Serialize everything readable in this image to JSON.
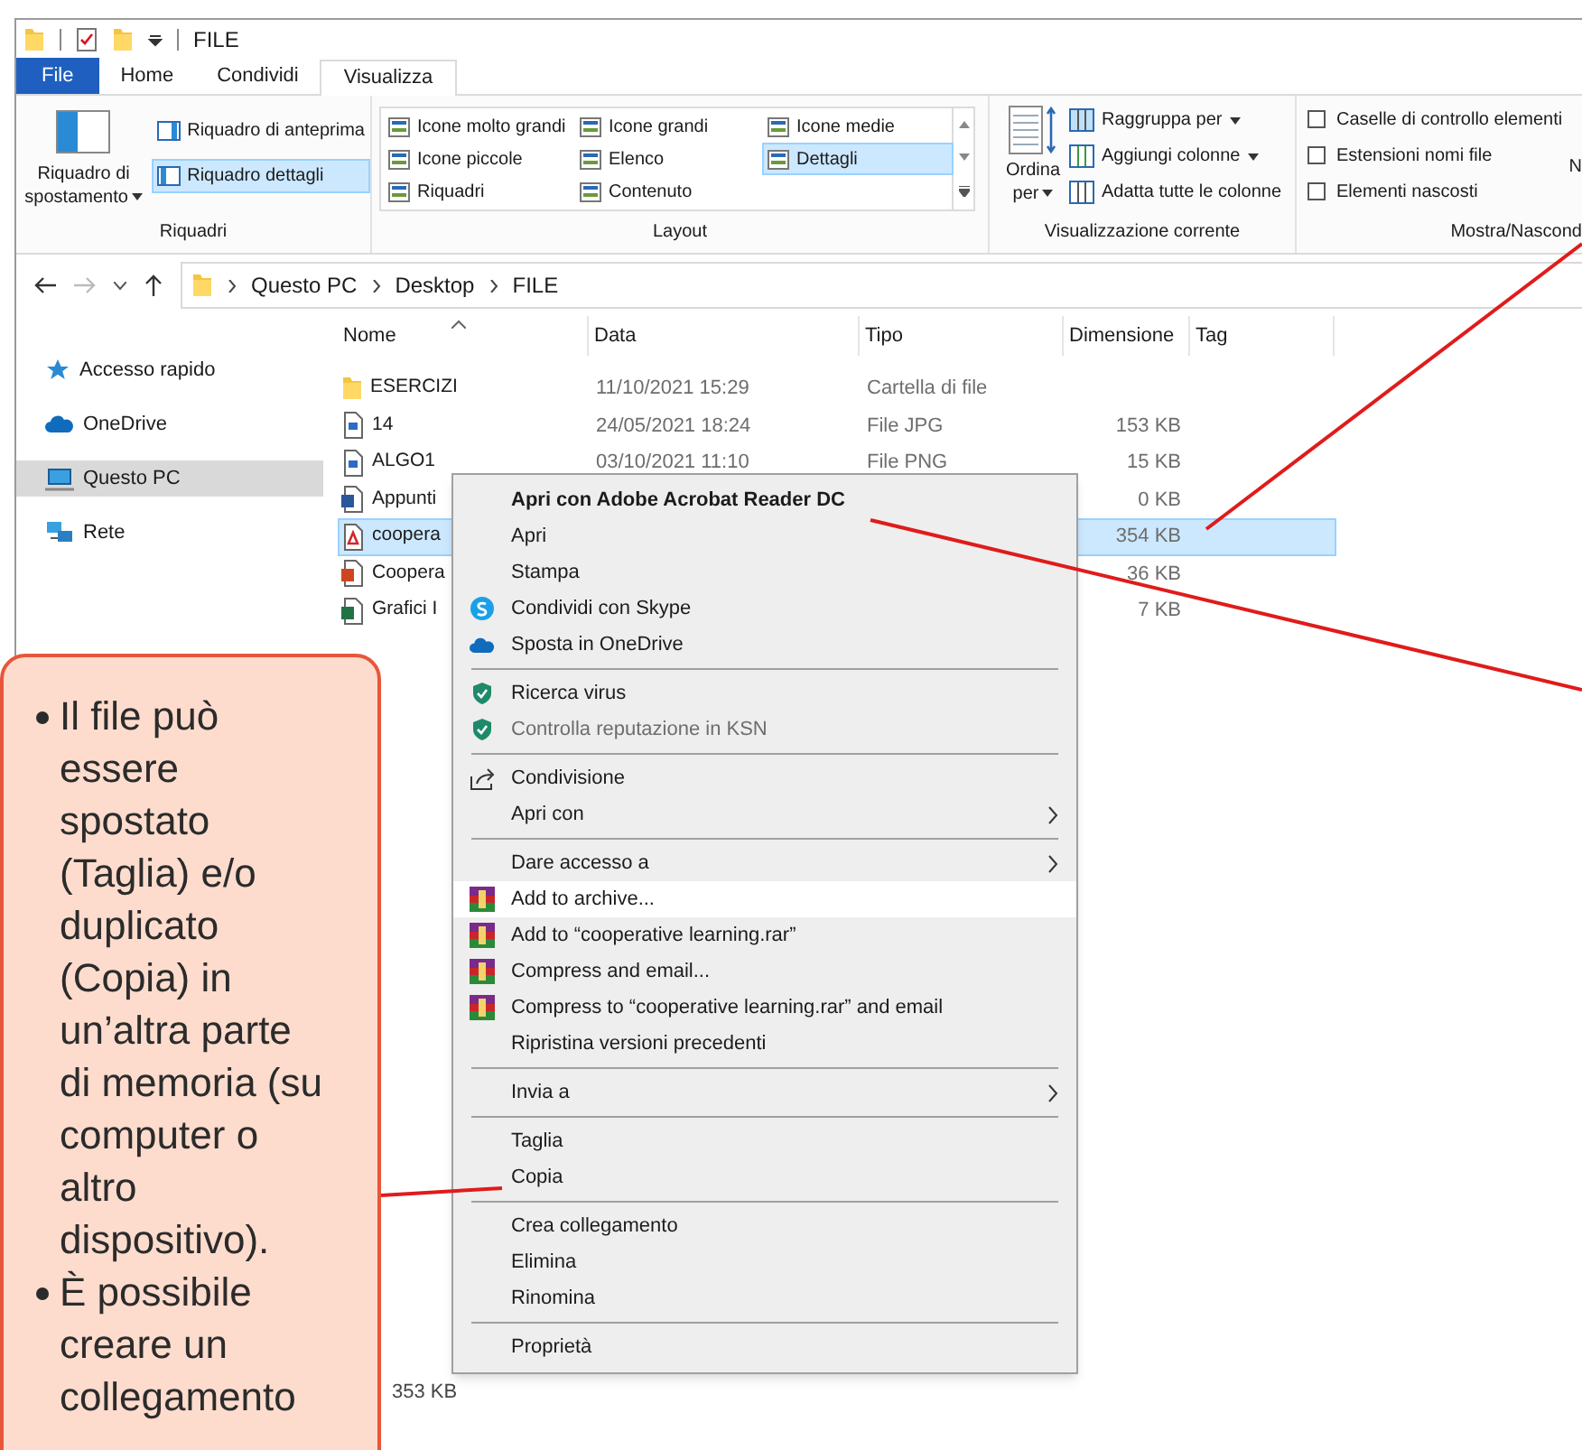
{
  "title_bar": {
    "title": "FILE"
  },
  "ribbon": {
    "tabs": [
      {
        "label": "File",
        "kind": "file",
        "selected": false
      },
      {
        "label": "Home",
        "kind": "tab",
        "selected": false
      },
      {
        "label": "Condividi",
        "kind": "tab",
        "selected": false
      },
      {
        "label": "Visualizza",
        "kind": "tab",
        "selected": true
      }
    ],
    "panes": {
      "label": "Riquadri",
      "navigation_pane": "Riquadro di spostamento",
      "buttons": [
        {
          "label": "Riquadro di anteprima",
          "selected": false
        },
        {
          "label": "Riquadro dettagli",
          "selected": true
        }
      ]
    },
    "layout": {
      "label": "Layout",
      "options": [
        {
          "label": "Icone molto grandi",
          "selected": false
        },
        {
          "label": "Icone piccole",
          "selected": false
        },
        {
          "label": "Riquadri",
          "selected": false
        },
        {
          "label": "Icone grandi",
          "selected": false
        },
        {
          "label": "Elenco",
          "selected": false
        },
        {
          "label": "Contenuto",
          "selected": false
        },
        {
          "label": "Icone medie",
          "selected": false
        },
        {
          "label": "Dettagli",
          "selected": true
        }
      ]
    },
    "current_view": {
      "label": "Visualizzazione corrente",
      "sort_button": "Ordina per",
      "buttons": [
        {
          "label": "Raggruppa per",
          "dropdown": true
        },
        {
          "label": "Aggiungi colonne",
          "dropdown": true
        },
        {
          "label": "Adatta tutte le colonne",
          "dropdown": false
        }
      ]
    },
    "show_hide": {
      "label": "Mostra/Nascond",
      "checkboxes": [
        {
          "label": "Caselle di controllo elementi",
          "checked": false
        },
        {
          "label": "Estensioni nomi file",
          "checked": false
        },
        {
          "label": "Elementi nascosti",
          "checked": false
        }
      ],
      "cut_button": "N"
    }
  },
  "address_bar": {
    "path": [
      "Questo PC",
      "Desktop",
      "FILE"
    ]
  },
  "navigation_pane": {
    "items": [
      {
        "label": "Accesso rapido",
        "kind": "star",
        "selected": false
      },
      {
        "label": "OneDrive",
        "kind": "cloud",
        "selected": false
      },
      {
        "label": "Questo PC",
        "kind": "pc",
        "selected": true
      },
      {
        "label": "Rete",
        "kind": "network",
        "selected": false
      }
    ]
  },
  "file_list": {
    "columns": [
      "Nome",
      "Data",
      "Tipo",
      "Dimensione",
      "Tag"
    ],
    "rows": [
      {
        "name": "ESERCIZI",
        "kind": "folder",
        "date": "11/10/2021 15:29",
        "type": "Cartella di file",
        "selected": false
      },
      {
        "name": "14",
        "kind": "image",
        "date": "24/05/2021 18:24",
        "type": "File JPG",
        "size": "153 KB",
        "selected": false
      },
      {
        "name": "ALGO1",
        "kind": "image",
        "date": "03/10/2021 11:10",
        "type": "File PNG",
        "size": "15 KB",
        "selected": false
      },
      {
        "name": "Appunti",
        "kind": "word",
        "size": "0 KB",
        "selected": false
      },
      {
        "name": "coopera",
        "kind": "pdf",
        "size": "354 KB",
        "selected": true
      },
      {
        "name": "Coopera",
        "kind": "powerpoint",
        "size": "36 KB",
        "selected": false
      },
      {
        "name": "Grafici I",
        "kind": "excel",
        "size": "7 KB",
        "selected": false
      }
    ]
  },
  "status_bar": {
    "text": "353 KB"
  },
  "context_menu": {
    "items": [
      {
        "kind": "item",
        "label": "Apri con Adobe Acrobat Reader DC",
        "bold": true,
        "disabled": false,
        "submenu": false,
        "highlighted": false
      },
      {
        "kind": "item",
        "label": "Apri",
        "bold": false,
        "disabled": false,
        "submenu": false,
        "highlighted": false
      },
      {
        "kind": "item",
        "label": "Stampa",
        "bold": false,
        "disabled": false,
        "submenu": false,
        "highlighted": false
      },
      {
        "kind": "item",
        "label": "Condividi con Skype",
        "bold": false,
        "disabled": false,
        "submenu": false,
        "highlighted": false
      },
      {
        "kind": "item",
        "label": "Sposta in OneDrive",
        "bold": false,
        "disabled": false,
        "submenu": false,
        "highlighted": false
      },
      {
        "kind": "separator"
      },
      {
        "kind": "item",
        "label": "Ricerca virus",
        "bold": false,
        "disabled": false,
        "submenu": false,
        "highlighted": false
      },
      {
        "kind": "item",
        "label": "Controlla reputazione in KSN",
        "bold": false,
        "disabled": true,
        "submenu": false,
        "highlighted": false
      },
      {
        "kind": "separator"
      },
      {
        "kind": "item",
        "label": "Condivisione",
        "bold": false,
        "disabled": false,
        "submenu": false,
        "highlighted": false
      },
      {
        "kind": "item",
        "label": "Apri con",
        "bold": false,
        "disabled": false,
        "submenu": true,
        "highlighted": false
      },
      {
        "kind": "separator"
      },
      {
        "kind": "item",
        "label": "Dare accesso a",
        "bold": false,
        "disabled": false,
        "submenu": true,
        "highlighted": false
      },
      {
        "kind": "item",
        "label": "Add to archive...",
        "bold": false,
        "disabled": false,
        "submenu": false,
        "highlighted": true
      },
      {
        "kind": "item",
        "label": "Add to “cooperative learning.rar”",
        "bold": false,
        "disabled": false,
        "submenu": false,
        "highlighted": false
      },
      {
        "kind": "item",
        "label": "Compress and email...",
        "bold": false,
        "disabled": false,
        "submenu": false,
        "highlighted": false
      },
      {
        "kind": "item",
        "label": "Compress to “cooperative learning.rar” and email",
        "bold": false,
        "disabled": false,
        "submenu": false,
        "highlighted": false
      },
      {
        "kind": "item",
        "label": "Ripristina versioni precedenti",
        "bold": false,
        "disabled": false,
        "submenu": false,
        "highlighted": false
      },
      {
        "kind": "separator"
      },
      {
        "kind": "item",
        "label": "Invia a",
        "bold": false,
        "disabled": false,
        "submenu": true,
        "highlighted": false
      },
      {
        "kind": "separator"
      },
      {
        "kind": "item",
        "label": "Taglia",
        "bold": false,
        "disabled": false,
        "submenu": false,
        "highlighted": false
      },
      {
        "kind": "item",
        "label": "Copia",
        "bold": false,
        "disabled": false,
        "submenu": false,
        "highlighted": false
      },
      {
        "kind": "separator"
      },
      {
        "kind": "item",
        "label": "Crea collegamento",
        "bold": false,
        "disabled": false,
        "submenu": false,
        "highlighted": false
      },
      {
        "kind": "item",
        "label": "Elimina",
        "bold": false,
        "disabled": false,
        "submenu": false,
        "highlighted": false
      },
      {
        "kind": "item",
        "label": "Rinomina",
        "bold": false,
        "disabled": false,
        "submenu": false,
        "highlighted": false
      },
      {
        "kind": "separator"
      },
      {
        "kind": "item",
        "label": "Proprietà",
        "bold": false,
        "disabled": false,
        "submenu": false,
        "highlighted": false
      }
    ]
  },
  "callout": {
    "bullets": [
      "Il file può essere spostato (Taglia) e/o duplicato (Copia) in un’altra parte di memoria (su computer o altro dispositivo).",
      "È possibile creare un collegamento"
    ]
  }
}
